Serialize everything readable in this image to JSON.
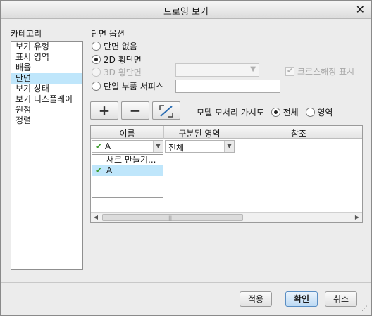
{
  "window": {
    "title": "드로잉 보기",
    "close_label": "✕"
  },
  "categories": {
    "label": "카테고리",
    "items": [
      "보기 유형",
      "표시 영역",
      "배율",
      "단면",
      "보기 상태",
      "보기 디스플레이",
      "원점",
      "정렬"
    ],
    "selected": "단면"
  },
  "section_options": {
    "label": "단면 옵션",
    "no_section": "단면 없음",
    "section_2d": "2D 횡단면",
    "section_3d": "3D 횡단면",
    "single_part": "단일 부품 서피스",
    "crosshatch": "크로스해칭 표시",
    "selected": "2D 횡단면"
  },
  "toolbar": {
    "add": "+",
    "remove": "−"
  },
  "edge_visibility": {
    "label": "모델 모서리 가시도",
    "all": "전체",
    "area": "영역",
    "selected": "전체"
  },
  "table": {
    "headers": [
      "이름",
      "구분된 영역",
      "참조"
    ],
    "row": {
      "name": "A",
      "region": "전체",
      "reference": ""
    },
    "dropdown": [
      {
        "label": "새로 만들기...",
        "checked": false
      },
      {
        "label": "A",
        "checked": true
      }
    ]
  },
  "buttons": {
    "apply": "적용",
    "ok": "확인",
    "cancel": "취소"
  },
  "colors": {
    "selection": "#bfe6fb",
    "check": "#3a9a2a",
    "ok_border": "#5a8ec3"
  }
}
